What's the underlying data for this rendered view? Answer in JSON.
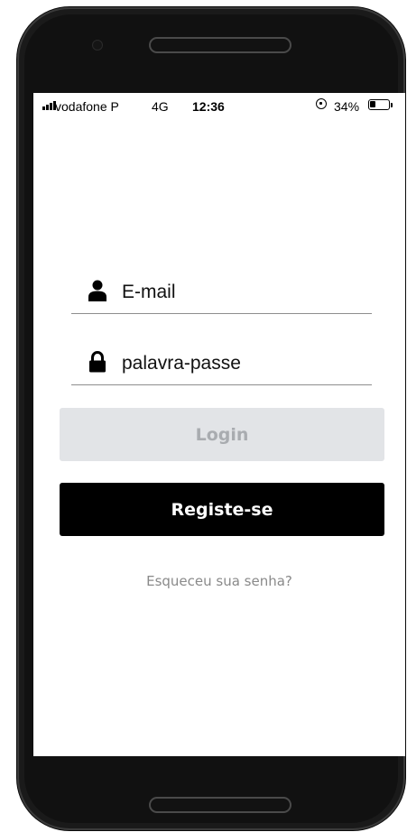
{
  "status_bar": {
    "carrier": "vodafone P",
    "network": "4G",
    "time": "12:36",
    "battery_percent": "34%",
    "battery_level": 0.34
  },
  "login_form": {
    "email_placeholder": "E-mail",
    "email_icon": "user-icon",
    "password_placeholder": "palavra-passe",
    "password_icon": "lock-icon",
    "login_label": "Login",
    "register_label": "Registe-se",
    "forgot_password_label": "Esqueceu sua senha?"
  },
  "colors": {
    "login_button_bg": "#e2e4e7",
    "login_button_text": "#a9acb0",
    "register_button_bg": "#000000",
    "register_button_text": "#ffffff",
    "link_text": "#8a8a8a"
  }
}
